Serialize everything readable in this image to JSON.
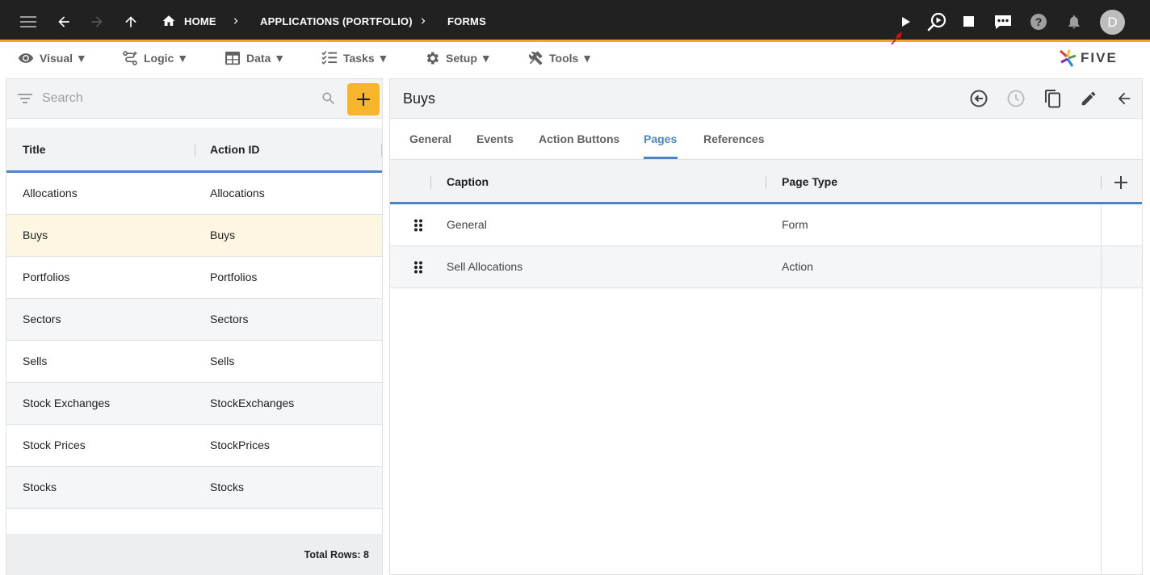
{
  "topbar": {
    "breadcrumbs": [
      "HOME",
      "APPLICATIONS (PORTFOLIO)",
      "FORMS"
    ],
    "avatar_initial": "D",
    "icons": [
      "menu-icon",
      "back-icon",
      "forward-icon",
      "up-icon",
      "home-icon",
      "run-icon",
      "preview-icon",
      "stop-icon",
      "chat-icon",
      "help-icon",
      "bell-icon"
    ]
  },
  "menubar": {
    "items": [
      "Visual ▼",
      "Logic ▼",
      "Data ▼",
      "Tasks ▼",
      "Setup ▼",
      "Tools ▼"
    ],
    "logo_text": "FIVE"
  },
  "left": {
    "search_placeholder": "Search",
    "columns": [
      "Title",
      "Action ID"
    ],
    "rows": [
      {
        "title": "Allocations",
        "action_id": "Allocations"
      },
      {
        "title": "Buys",
        "action_id": "Buys"
      },
      {
        "title": "Portfolios",
        "action_id": "Portfolios"
      },
      {
        "title": "Sectors",
        "action_id": "Sectors"
      },
      {
        "title": "Sells",
        "action_id": "Sells"
      },
      {
        "title": "Stock Exchanges",
        "action_id": "StockExchanges"
      },
      {
        "title": "Stock Prices",
        "action_id": "StockPrices"
      },
      {
        "title": "Stocks",
        "action_id": "Stocks"
      }
    ],
    "footer": "Total Rows: 8"
  },
  "right": {
    "title": "Buys",
    "tabs": [
      "General",
      "Events",
      "Action Buttons",
      "Pages",
      "References"
    ],
    "active_tab": "Pages",
    "columns": [
      "Caption",
      "Page Type"
    ],
    "rows": [
      {
        "caption": "General",
        "page_type": "Form"
      },
      {
        "caption": "Sell Allocations",
        "page_type": "Action"
      }
    ]
  },
  "colors": {
    "topbar": "#212121",
    "accent_orange": "#f5a623",
    "add_button": "#f7b52c",
    "accent_blue": "#4a86c5",
    "selected_row": "#fdf6e3",
    "annotation_arrow": "#e01010"
  }
}
